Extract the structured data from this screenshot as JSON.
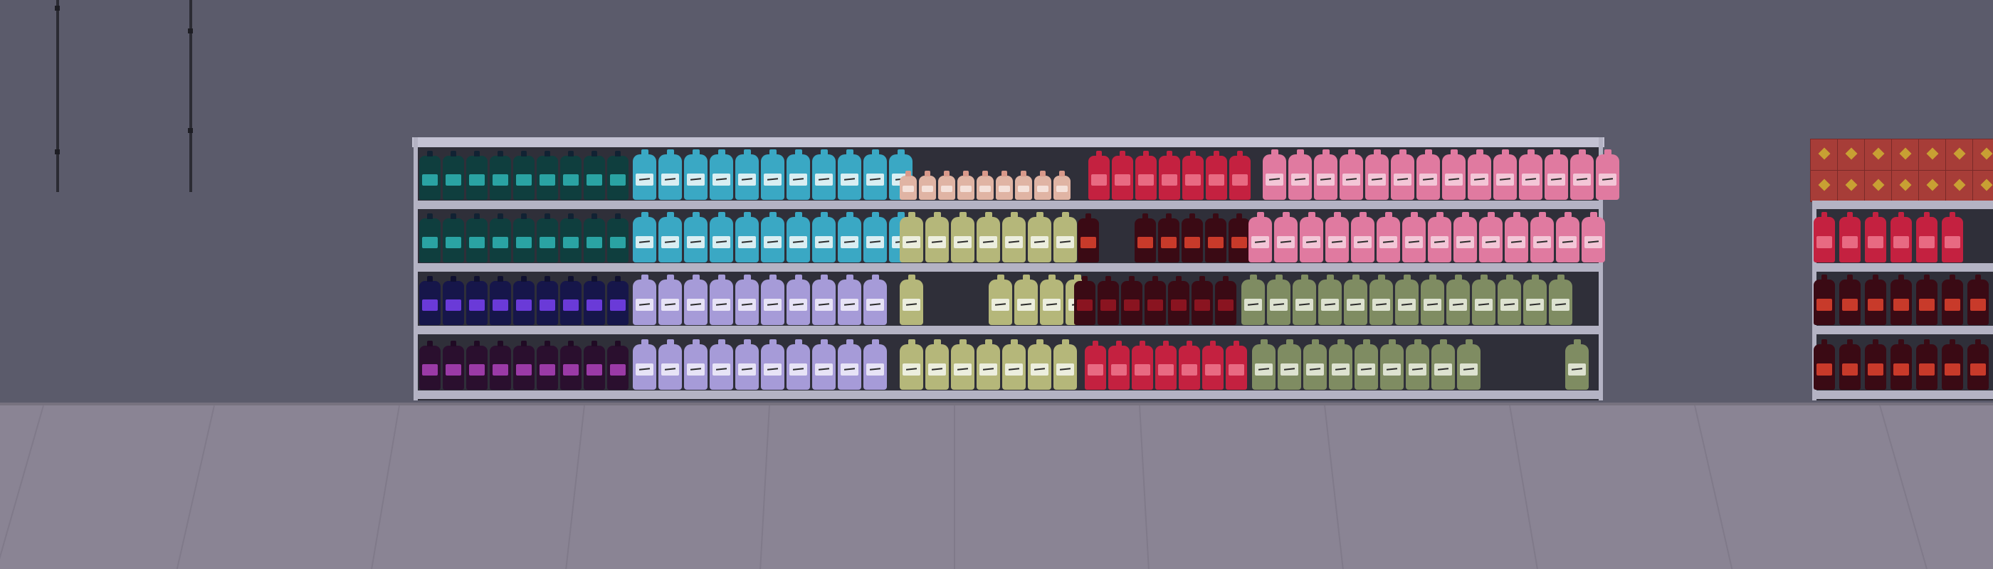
{
  "scene": {
    "type": "3d-store-aisle",
    "colors": {
      "wall": "#5b5b6b",
      "floor": "#8a8494",
      "shelf_frame": "#b4b3c4",
      "shelf_back": "#2f2f39"
    }
  },
  "main_shelf": {
    "rows": [
      {
        "segments": [
          {
            "product": "dark-teal-bottle",
            "count": 9,
            "body": "#0f3e3e",
            "label": "#2aa3a3",
            "cap": "#123"
          },
          {
            "product": "light-blue-jug",
            "count": 11,
            "body": "#3aa8c4",
            "label": "#d9eef2",
            "cap": "#3aa8c4"
          },
          {
            "product": "small-peach-bottle",
            "count": 9,
            "body": "#e0b4a4",
            "label": "#f4e1da",
            "cap": "#d9998a"
          },
          {
            "product": "red-bottle",
            "count": 7,
            "body": "#c42140",
            "label": "#e86a82",
            "cap": "#c42140"
          },
          {
            "product": "pink-jug",
            "count": 14,
            "body": "#e07aa0",
            "label": "#f3c6d7",
            "cap": "#e07aa0"
          }
        ]
      },
      {
        "segments": [
          {
            "product": "dark-teal-bottle",
            "count": 9,
            "body": "#0f3e3e",
            "label": "#2aa3a3",
            "cap": "#123"
          },
          {
            "product": "light-blue-jug",
            "count": 11,
            "body": "#3aa8c4",
            "label": "#d9eef2",
            "cap": "#3aa8c4"
          },
          {
            "product": "olive-jug",
            "count": 7,
            "body": "#b5b77a",
            "label": "#eceede",
            "cap": "#b5b77a"
          },
          {
            "product": "cola-bottle",
            "count": 1,
            "body": "#3a0a14",
            "label": "#c83a2a",
            "cap": "#3a0a14"
          },
          {
            "product": "cola-bottle",
            "count": 5,
            "body": "#3a0a14",
            "label": "#c83a2a",
            "cap": "#3a0a14",
            "offset": 1
          },
          {
            "product": "pink-jug",
            "count": 14,
            "body": "#e07aa0",
            "label": "#f3c6d7",
            "cap": "#e07aa0"
          }
        ]
      },
      {
        "segments": [
          {
            "product": "navy-purple-bottle",
            "count": 9,
            "body": "#16164a",
            "label": "#6a3ad8",
            "cap": "#101030"
          },
          {
            "product": "lavender-jug",
            "count": 10,
            "body": "#a69bd8",
            "label": "#e7e3f6",
            "cap": "#a69bd8"
          },
          {
            "product": "olive-jug",
            "count": 1,
            "body": "#b5b77a",
            "label": "#eceede",
            "cap": "#b5b77a"
          },
          {
            "product": "olive-jug",
            "count": 4,
            "body": "#b5b77a",
            "label": "#eceede",
            "cap": "#b5b77a",
            "offset": 2
          },
          {
            "product": "dark-red-bottle",
            "count": 7,
            "body": "#3a0a14",
            "label": "#8a1420",
            "cap": "#3a0a14"
          },
          {
            "product": "sage-jug",
            "count": 13,
            "body": "#7f8c62",
            "label": "#dde2d0",
            "cap": "#7f8c62"
          }
        ]
      },
      {
        "segments": [
          {
            "product": "plum-bottle",
            "count": 9,
            "body": "#2a0f2e",
            "label": "#9a3aa6",
            "cap": "#200a24"
          },
          {
            "product": "lavender-jug",
            "count": 10,
            "body": "#a69bd8",
            "label": "#e7e3f6",
            "cap": "#a69bd8"
          },
          {
            "product": "olive-jug",
            "count": 7,
            "body": "#b5b77a",
            "label": "#eceede",
            "cap": "#b5b77a"
          },
          {
            "product": "red-bottle",
            "count": 7,
            "body": "#c42140",
            "label": "#e86a82",
            "cap": "#c42140"
          },
          {
            "product": "sage-jug",
            "count": 9,
            "body": "#7f8c62",
            "label": "#dde2d0",
            "cap": "#7f8c62"
          },
          {
            "product": "sage-jug",
            "count": 1,
            "body": "#7f8c62",
            "label": "#dde2d0",
            "cap": "#7f8c62",
            "offset": 3
          }
        ]
      }
    ]
  },
  "side_shelf": {
    "top_boxes": {
      "count": 7,
      "rows": 2,
      "body": "#a73d38",
      "mark": "#c8a033"
    },
    "rows": [
      {
        "product": "red-bottle",
        "count": 6,
        "body": "#c42140",
        "label": "#e86a82",
        "cap": "#c42140",
        "gap_after": 4
      },
      {
        "product": "cola-bottle",
        "count": 7,
        "body": "#3a0a14",
        "label": "#c83a2a",
        "cap": "#3a0a14"
      },
      {
        "product": "cola-bottle",
        "count": 7,
        "body": "#3a0a14",
        "label": "#c83a2a",
        "cap": "#3a0a14"
      }
    ]
  }
}
